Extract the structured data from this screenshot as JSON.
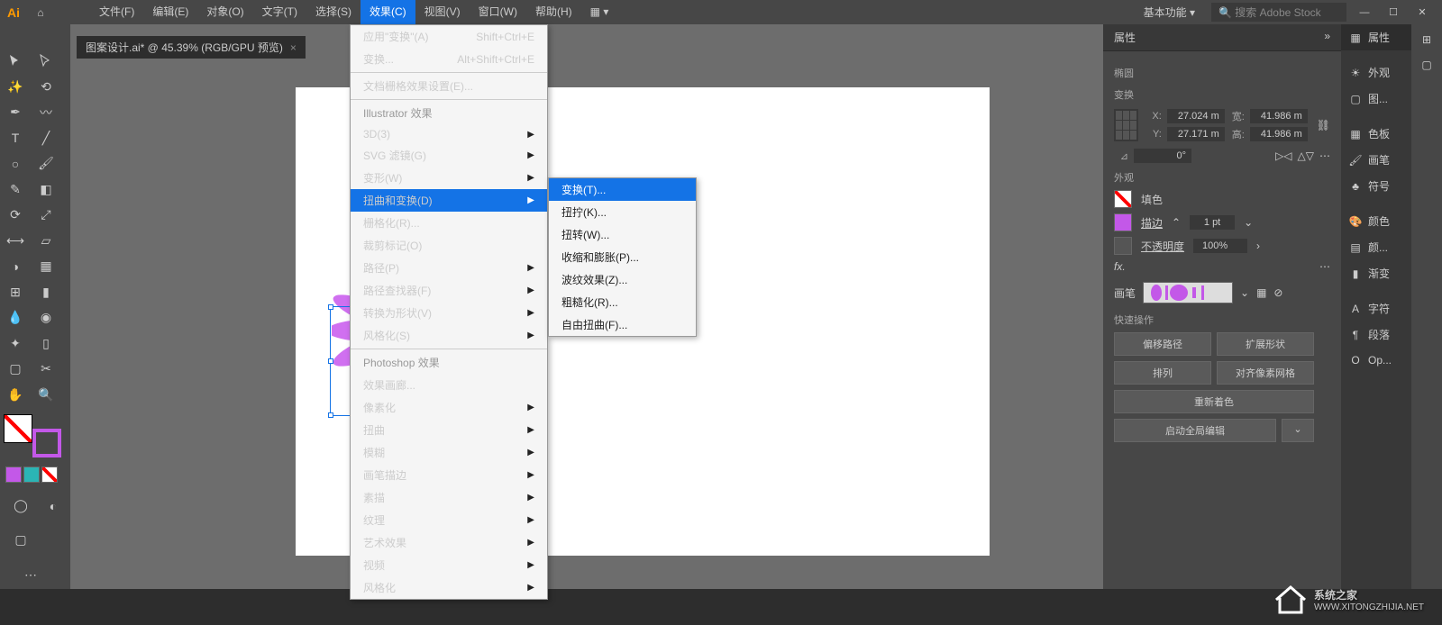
{
  "menubar": {
    "file": "文件(F)",
    "edit": "编辑(E)",
    "object": "对象(O)",
    "type": "文字(T)",
    "select": "选择(S)",
    "effect": "效果(C)",
    "view": "视图(V)",
    "window": "窗口(W)",
    "help": "帮助(H)",
    "workspace": "基本功能",
    "search_placeholder": "搜索 Adobe Stock"
  },
  "doc_tab": "图案设计.ai* @ 45.39% (RGB/GPU 预览)",
  "dropdown": {
    "apply_transform": "应用\"变换\"(A)",
    "apply_shortcut": "Shift+Ctrl+E",
    "transform": "变换...",
    "transform_shortcut": "Alt+Shift+Ctrl+E",
    "doc_raster": "文档栅格效果设置(E)...",
    "section_ill": "Illustrator 效果",
    "three_d": "3D(3)",
    "svg": "SVG 滤镜(G)",
    "warp": "变形(W)",
    "distort": "扭曲和变换(D)",
    "rasterize": "栅格化(R)...",
    "crop": "裁剪标记(O)",
    "path": "路径(P)",
    "pathfinder": "路径查找器(F)",
    "convert": "转换为形状(V)",
    "stylize": "风格化(S)",
    "section_ps": "Photoshop 效果",
    "gallery": "效果画廊...",
    "pixelate": "像素化",
    "distort2": "扭曲",
    "blur": "模糊",
    "brush_strokes": "画笔描边",
    "sketch": "素描",
    "texture": "纹理",
    "artistic": "艺术效果",
    "video": "视频",
    "stylize2": "风格化"
  },
  "submenu": {
    "transform": "变换(T)...",
    "twist": "扭拧(K)...",
    "twirl": "扭转(W)...",
    "pucker": "收缩和膨胀(P)...",
    "zigzag": "波纹效果(Z)...",
    "roughen": "粗糙化(R)...",
    "free_distort": "自由扭曲(F)..."
  },
  "props": {
    "tab": "属性",
    "subtitle": "椭圆",
    "transform_label": "变换",
    "x_label": "X:",
    "y_label": "Y:",
    "w_label": "宽:",
    "h_label": "高:",
    "x": "27.024 m",
    "y": "27.171 m",
    "w": "41.986 m",
    "h": "41.986 m",
    "angle": "0°",
    "appearance_label": "外观",
    "fill_label": "填色",
    "stroke_label": "描边",
    "stroke_width": "1 pt",
    "opacity_label": "不透明度",
    "opacity": "100%",
    "fx": "fx.",
    "brush_label": "画笔",
    "quick_label": "快速操作",
    "offset_path": "偏移路径",
    "expand_shape": "扩展形状",
    "arrange": "排列",
    "align_pixel": "对齐像素网格",
    "recolor": "重新着色",
    "start_global": "启动全局编辑"
  },
  "dock": {
    "properties": "属性",
    "appearance": "外观",
    "graphic_styles": "图...",
    "swatches": "色板",
    "brushes": "画笔",
    "symbols": "符号",
    "color": "颜色",
    "color_guide": "颜...",
    "gradient": "渐变",
    "character": "字符",
    "paragraph": "段落",
    "opentype": "Op..."
  },
  "watermark": {
    "main": "系统之家",
    "url": "WWW.XITONGZHIJIA.NET"
  }
}
